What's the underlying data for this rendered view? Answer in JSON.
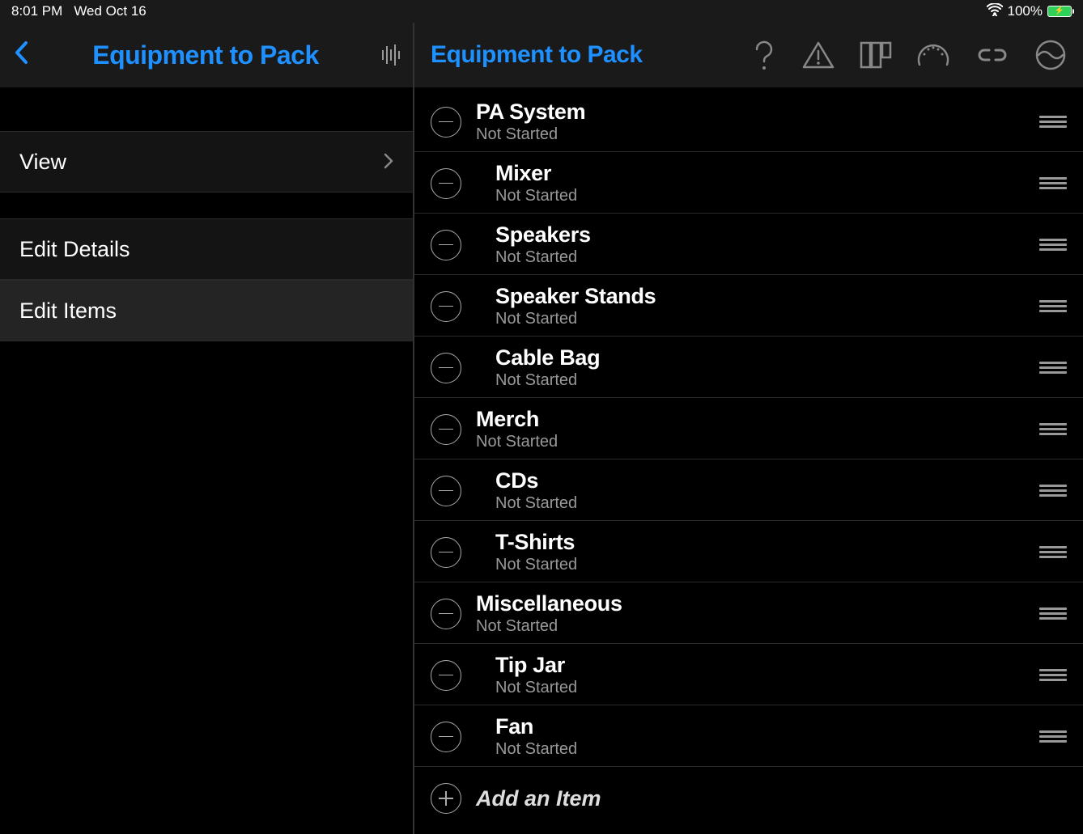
{
  "status": {
    "time": "8:01 PM",
    "date": "Wed Oct 16",
    "battery": "100%"
  },
  "left": {
    "title": "Equipment to Pack",
    "menu": {
      "view": "View",
      "edit_details": "Edit Details",
      "edit_items": "Edit Items"
    }
  },
  "right": {
    "title": "Equipment to Pack",
    "add_label": "Add an Item",
    "items": [
      {
        "title": "PA System",
        "status": "Not Started",
        "indent": 0
      },
      {
        "title": "Mixer",
        "status": "Not Started",
        "indent": 1
      },
      {
        "title": "Speakers",
        "status": "Not Started",
        "indent": 1
      },
      {
        "title": "Speaker Stands",
        "status": "Not Started",
        "indent": 1
      },
      {
        "title": "Cable Bag",
        "status": "Not Started",
        "indent": 1
      },
      {
        "title": "Merch",
        "status": "Not Started",
        "indent": 0
      },
      {
        "title": "CDs",
        "status": "Not Started",
        "indent": 1
      },
      {
        "title": "T-Shirts",
        "status": "Not Started",
        "indent": 1
      },
      {
        "title": "Miscellaneous",
        "status": "Not Started",
        "indent": 0
      },
      {
        "title": "Tip Jar",
        "status": "Not Started",
        "indent": 1
      },
      {
        "title": "Fan",
        "status": "Not Started",
        "indent": 1
      }
    ]
  }
}
